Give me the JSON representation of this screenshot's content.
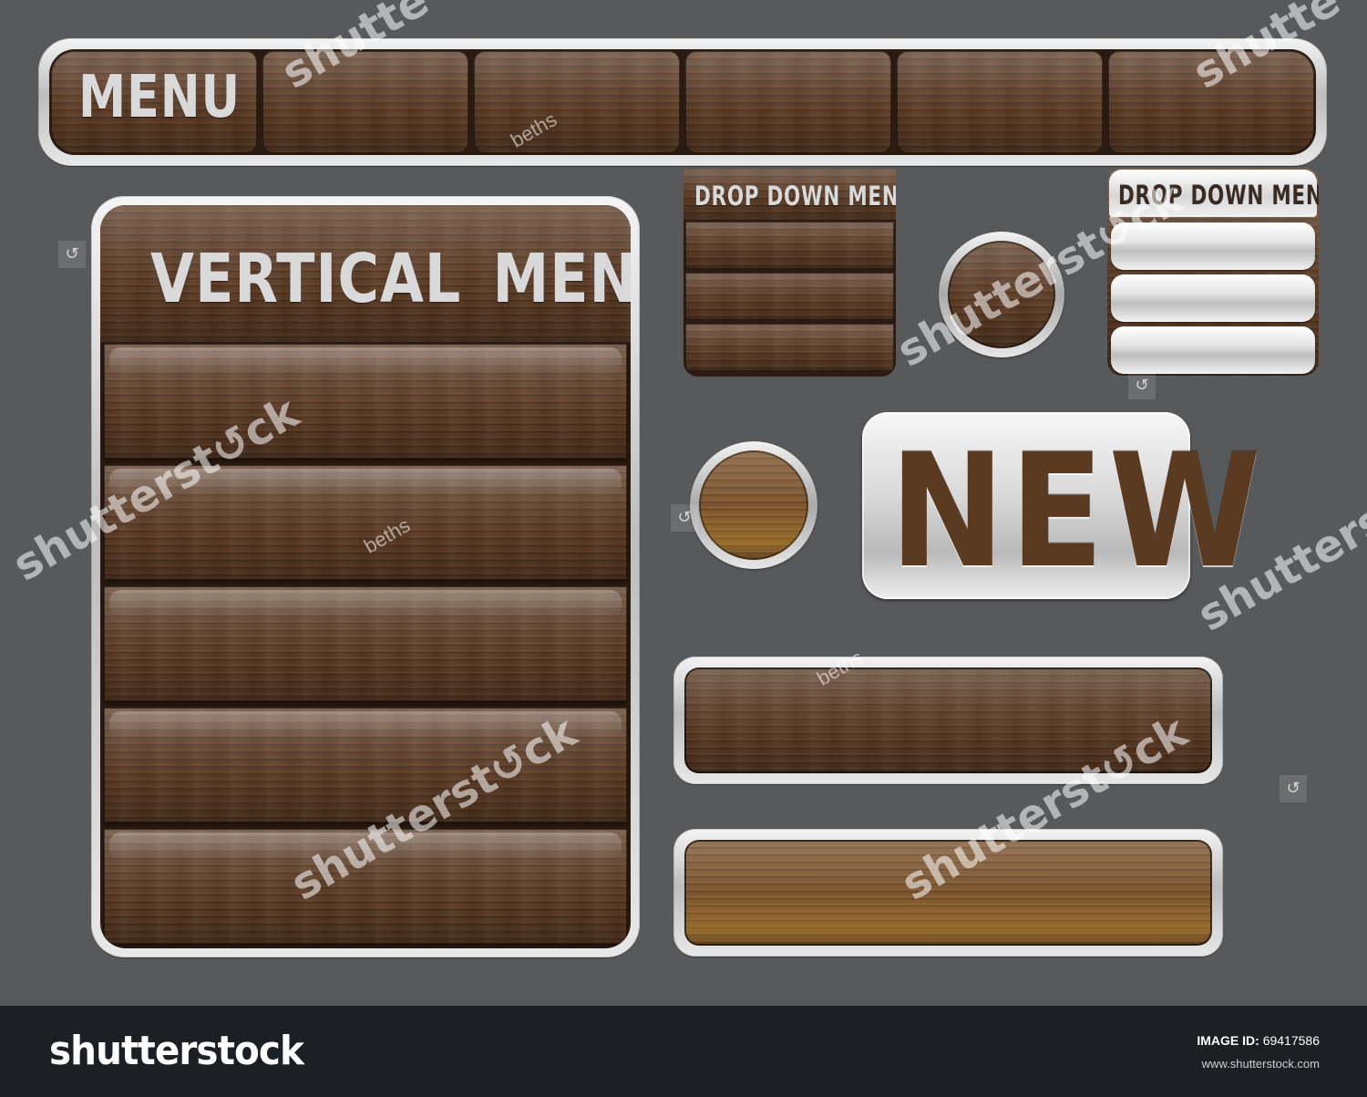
{
  "top_menu": {
    "label": "MENU",
    "tabs": [
      "",
      "",
      "",
      "",
      ""
    ]
  },
  "vertical_menu": {
    "title": "VERTICAL MENU",
    "rows": 5
  },
  "dropdowns": [
    {
      "title": "DROP DOWN MENU",
      "style": "wood",
      "items": 3
    },
    {
      "title": "DROP DOWN MENU",
      "style": "silver",
      "items": 3
    }
  ],
  "new_badge": {
    "text": "NEW"
  },
  "watermark": {
    "logo": "shutterstock",
    "id_label": "IMAGE ID:",
    "id_value": "69417586",
    "url": "www.shutterstock.com",
    "author": "beths"
  },
  "colors": {
    "background": "#58595b",
    "wood_dark": "#5a3a24",
    "wood_light": "#7d5630",
    "silver": "#d8d8d8",
    "footer": "#1c1f24"
  }
}
